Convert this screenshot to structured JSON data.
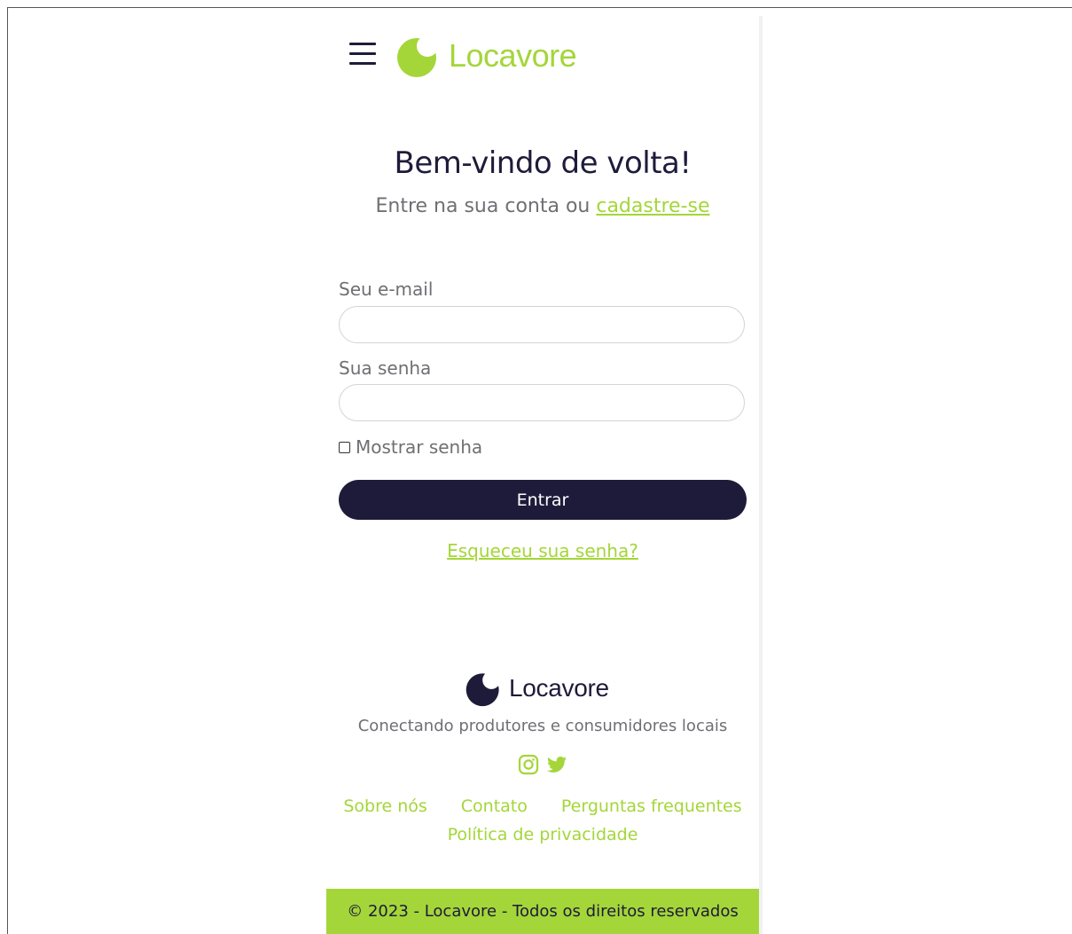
{
  "brand": {
    "name": "Locavore",
    "accent_color": "#a4d639",
    "dark_color": "#1e1b3a"
  },
  "header": {
    "menu_icon": "hamburger-menu-icon",
    "logo_icon": "locavore-logo-icon"
  },
  "login": {
    "title": "Bem-vindo de volta!",
    "subtitle_prefix": "Entre na sua conta ou",
    "signup_link": "cadastre-se",
    "email_label": "Seu e-mail",
    "email_value": "",
    "password_label": "Sua senha",
    "password_value": "",
    "show_password_label": "Mostrar senha",
    "show_password_checked": false,
    "submit_label": "Entrar",
    "forgot_link": "Esqueceu sua senha?"
  },
  "footer": {
    "tagline": "Conectando produtores e consumidores locais",
    "social_icons": [
      "instagram-icon",
      "twitter-icon"
    ],
    "links": [
      "Sobre nós",
      "Contato",
      "Perguntas frequentes",
      "Política de privacidade"
    ],
    "copyright": "© 2023 - Locavore - Todos os direitos reservados"
  }
}
